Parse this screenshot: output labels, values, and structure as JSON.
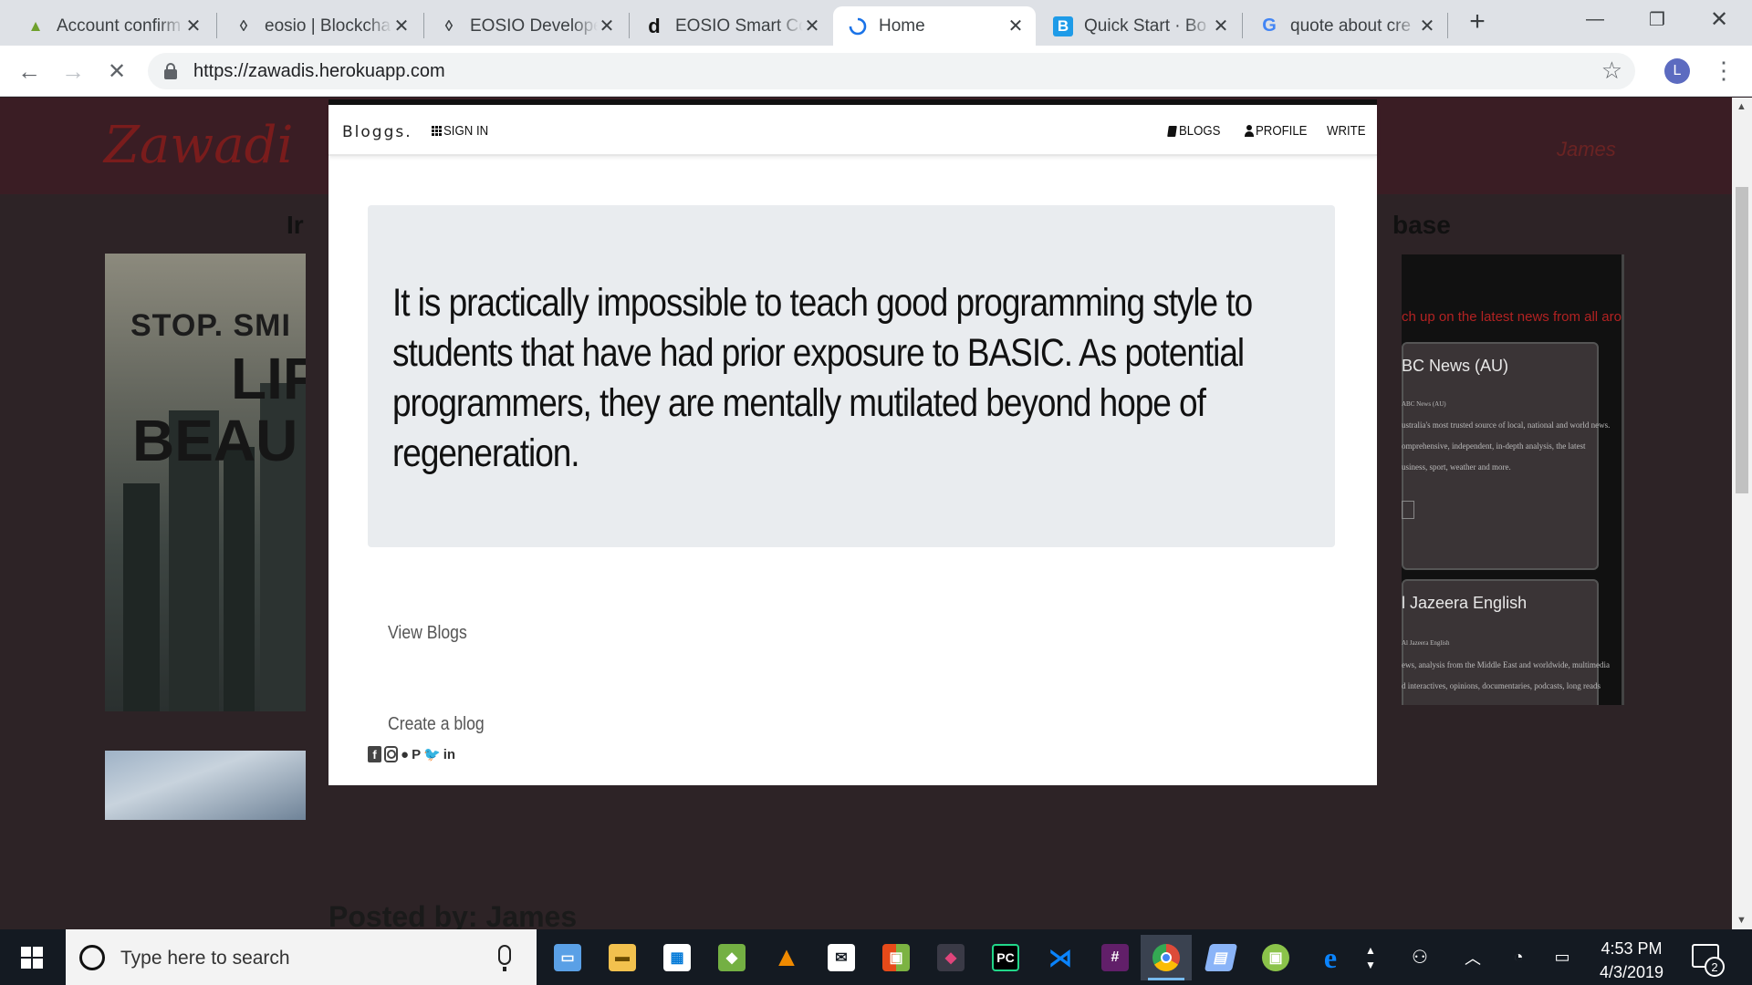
{
  "browser": {
    "tabs": [
      {
        "title": "Account confirm",
        "icon": "triangle-ledger-icon",
        "favicon_color": "#6fa02d"
      },
      {
        "title": "eosio | Blockcha",
        "icon": "eos-icon",
        "favicon_color": "#3c4043"
      },
      {
        "title": "EOSIO Develope",
        "icon": "eos-icon",
        "favicon_color": "#3c4043"
      },
      {
        "title": "EOSIO Smart Co",
        "icon": "d-logo-icon",
        "favicon_color": "#111111"
      },
      {
        "title": "Home",
        "icon": "loading-spinner-icon",
        "favicon_color": "#1a73e8"
      },
      {
        "title": "Quick Start · Bo",
        "icon": "bootstrap-b-icon",
        "favicon_color": "#1e9be8"
      },
      {
        "title": "quote about cre",
        "icon": "google-g-icon",
        "favicon_color": "#4285f4"
      }
    ],
    "url": "https://zawadis.herokuapp.com",
    "profile_initial": "L"
  },
  "page": {
    "logo": "Zawadi",
    "user": "James",
    "heading_left": "Ir",
    "heading_right": "base",
    "image_text": [
      "STOP. SMI",
      "LIF",
      "BEAU"
    ],
    "news": {
      "banner": "ch up on the latest news from all around th",
      "cards": [
        {
          "title": "BC News (AU)",
          "meta": "ABC News (AU)",
          "desc": [
            "ustralia's most trusted source of local, national and world news.",
            "omprehensive, independent, in-depth analysis, the latest",
            "usiness, sport, weather and more."
          ]
        },
        {
          "title": "l Jazeera English",
          "meta": "Al Jazeera English",
          "desc": [
            "ews, analysis from the Middle East and worldwide, multimedia",
            "d interactives, opinions, documentaries, podcasts, long reads"
          ]
        }
      ]
    },
    "posted_by": "Posted by: James"
  },
  "modal": {
    "brand": "Bloggs.",
    "nav": {
      "signin": "SIGN IN",
      "blogs": "BLOGS",
      "profile": "PROFILE",
      "write": "WRITE"
    },
    "quote": "It is practically impossible to teach good programming style to students that have had prior exposure to BASIC. As potential programmers, they are mentally mutilated beyond hope of regeneration.",
    "links": {
      "view_blogs": "View Blogs",
      "create_blog": "Create a blog"
    },
    "social": [
      "facebook-icon",
      "instagram-icon",
      "github-icon",
      "pinterest-icon",
      "twitter-icon",
      "linkedin-icon"
    ]
  },
  "taskbar": {
    "search_placeholder": "Type here to search",
    "time": "4:53 PM",
    "date": "4/3/2019",
    "notifications": "2",
    "apps": [
      {
        "name": "task-view-icon",
        "color": "#5aa0e6"
      },
      {
        "name": "file-explorer-icon",
        "color": "#f2c14e"
      },
      {
        "name": "store-icon",
        "color": "#ffffff"
      },
      {
        "name": "bluestacks-icon",
        "color": "#74b043"
      },
      {
        "name": "vlc-icon",
        "color": "#f08a00"
      },
      {
        "name": "mail-icon",
        "color": "#ffffff"
      },
      {
        "name": "office-icon",
        "color": "#e64a19"
      },
      {
        "name": "app-icon",
        "color": "#3a3a46"
      },
      {
        "name": "pycharm-icon",
        "color": "#21d789"
      },
      {
        "name": "vscode-icon",
        "color": "#0078d4"
      },
      {
        "name": "slack-icon",
        "color": "#611f69"
      },
      {
        "name": "chrome-icon",
        "color": "#dd4b39"
      },
      {
        "name": "notepad-icon",
        "color": "#8ab4f8"
      },
      {
        "name": "android-studio-icon",
        "color": "#8bc34a"
      },
      {
        "name": "edge-icon",
        "color": "#0078d7"
      }
    ]
  }
}
